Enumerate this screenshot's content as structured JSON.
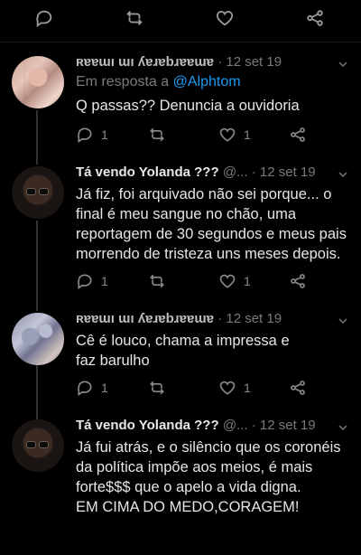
{
  "tweets": [
    {
      "name": "ʀɐɐɯı ɯı ʎɐɹɐbɹɐɐɯɐ",
      "handle": "",
      "date": "12 set 19",
      "reply_prefix": "Em resposta a",
      "reply_mention": "@Alphtom",
      "text": "Q passas?? Denuncia a ouvidoria",
      "replies": "1",
      "likes": "1"
    },
    {
      "name": "Tá vendo Yolanda ???",
      "handle": "@...",
      "date": "12 set 19",
      "text": "Já fiz, foi arquivado não sei porque... o final é meu sangue no chão, uma reportagem de 30 segundos e meus pais morrendo de tristeza uns meses depois.",
      "replies": "1",
      "likes": "1"
    },
    {
      "name": "ʀɐɐɯı ɯı ʎɐɹɐbɹɐɐɯɐ",
      "handle": "",
      "date": "12 set 19",
      "text": "Cê é louco, chama a impressa e faz barulho",
      "replies": "1",
      "likes": "1"
    },
    {
      "name": "Tá vendo Yolanda ???",
      "handle": "@...",
      "date": "12 set 19",
      "text": "Já fui atrás,  e o silêncio que os coronéis da política impõe aos meios,  é  mais forte$$$ que o apelo a vida digna.\nEM CIMA DO MEDO,CORAGEM!",
      "replies": "",
      "likes": ""
    }
  ],
  "icons": {
    "reply": "reply-icon",
    "retweet": "retweet-icon",
    "like": "heart-icon",
    "share": "share-icon",
    "caret": "chevron-down-icon"
  },
  "colors": {
    "background": "#000000",
    "text": "#e6e6e6",
    "muted": "#7a7a7a",
    "link": "#1d9bf0",
    "thread_line": "#2f3336"
  }
}
